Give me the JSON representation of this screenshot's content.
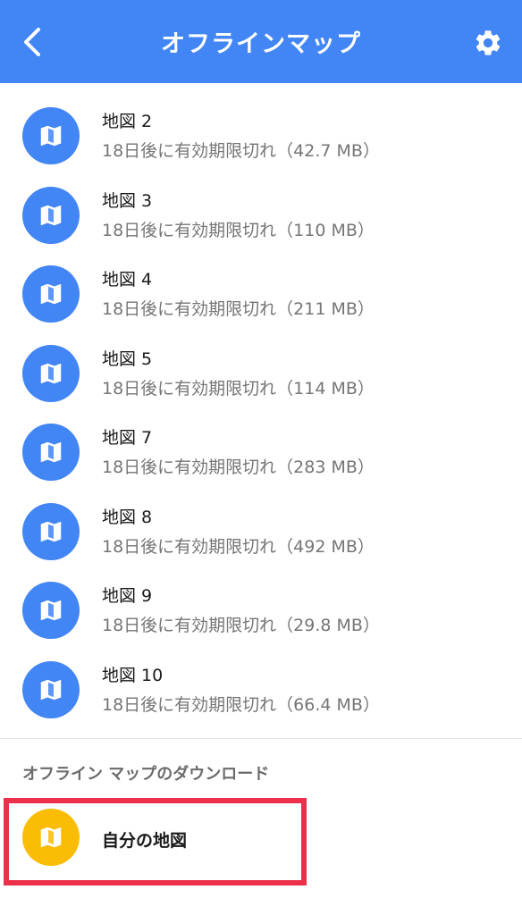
{
  "colors": {
    "brand": "#4285F4",
    "own_maps_icon": "#FBBC05",
    "highlight": "#EC2F4B"
  },
  "header": {
    "title": "オフラインマップ",
    "back_icon": "chevron-left-icon",
    "settings_icon": "gear-icon"
  },
  "maps": [
    {
      "name": "地図 2",
      "detail": "18日後に有効期限切れ（42.7 MB）"
    },
    {
      "name": "地図 3",
      "detail": "18日後に有効期限切れ（110 MB）"
    },
    {
      "name": "地図 4",
      "detail": "18日後に有効期限切れ（211 MB）"
    },
    {
      "name": "地図 5",
      "detail": "18日後に有効期限切れ（114 MB）"
    },
    {
      "name": "地図 7",
      "detail": "18日後に有効期限切れ（283 MB）"
    },
    {
      "name": "地図 8",
      "detail": "18日後に有効期限切れ（492 MB）"
    },
    {
      "name": "地図 9",
      "detail": "18日後に有効期限切れ（29.8 MB）"
    },
    {
      "name": "地図 10",
      "detail": "18日後に有効期限切れ（66.4 MB）"
    }
  ],
  "download_section": {
    "header": "オフライン マップのダウンロード",
    "own_maps_label": "自分の地図",
    "own_maps_icon": "map-icon"
  }
}
